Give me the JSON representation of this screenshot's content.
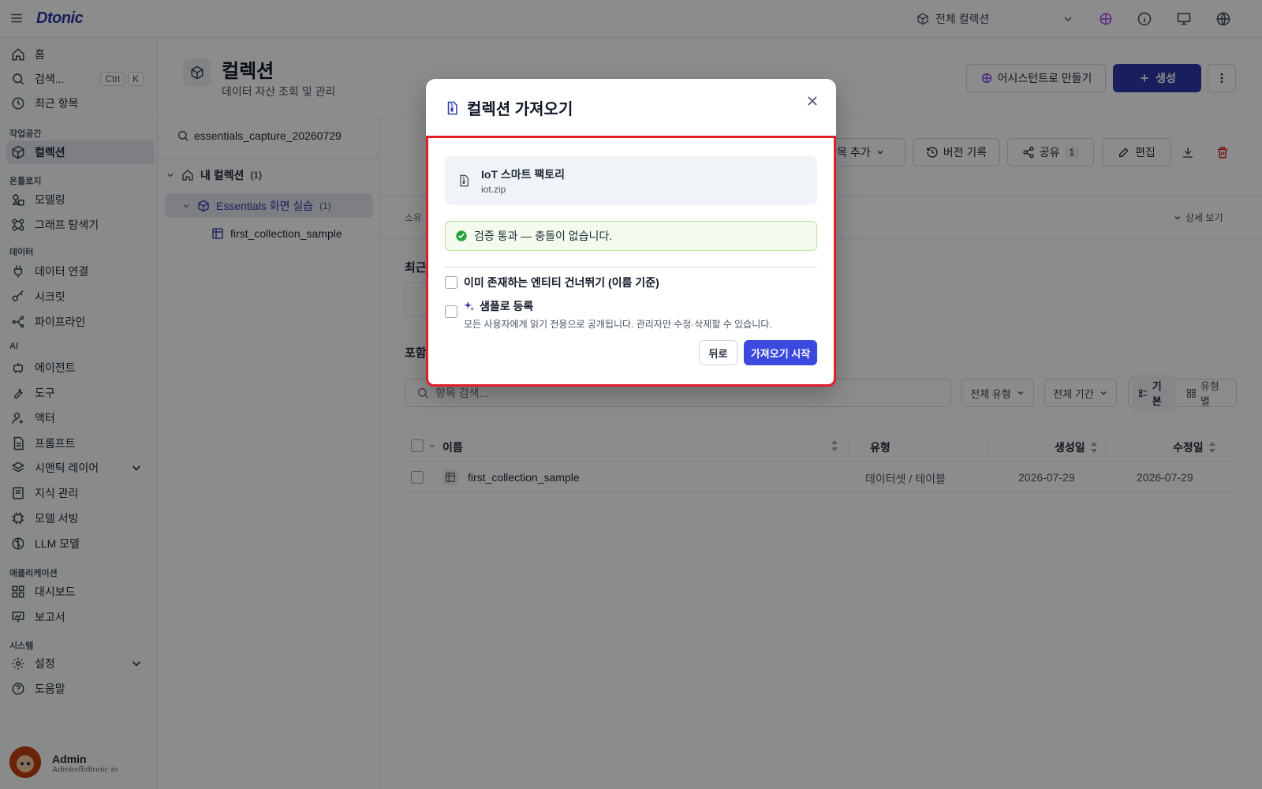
{
  "app": {
    "logo": "Dtonic"
  },
  "topbar": {
    "collection_select": "전체 컬렉션"
  },
  "sidebar": {
    "home": "홈",
    "search": "검색...",
    "search_kbd": [
      "Ctrl",
      "K"
    ],
    "recent": "최근 항목",
    "sections": {
      "workspace": "작업공간",
      "ontology": "온톨로지",
      "data": "데이터",
      "ai": "AI",
      "applications": "애플리케이션",
      "system": "시스템"
    },
    "items": {
      "collections": "컬렉션",
      "modeling": "모델링",
      "graph_explorer": "그래프 탐색기",
      "data_connect": "데이터 연결",
      "secrets": "시크릿",
      "pipelines": "파이프라인",
      "agents": "에이전트",
      "tools": "도구",
      "actors": "액터",
      "prompts": "프롬프트",
      "semantic_layer": "시맨틱 레이어",
      "knowledge": "지식 관리",
      "model_serving": "모델 서빙",
      "llm_models": "LLM 모델",
      "dashboards": "대시보드",
      "reports": "보고서",
      "settings": "설정",
      "help": "도움말"
    },
    "user": {
      "name": "Admin",
      "email": "Admin@dtonic.io"
    }
  },
  "page": {
    "title": "컬렉션",
    "subtitle": "데이터 자산 조회 및 관리",
    "assistant_button": "어시스턴트로 만들기",
    "create_button": "생성"
  },
  "tree": {
    "search_value": "essentials_capture_20260729",
    "root_label": "내 컬렉션",
    "root_count": "(1)",
    "child_label": "Essentials 화면 실습",
    "child_count": "(1)",
    "leaf_label": "first_collection_sample"
  },
  "main": {
    "toolbar": {
      "add_item": "항목 추가",
      "version_history": "버전 기록",
      "share": "공유",
      "share_count": "1",
      "edit": "편집"
    },
    "owner_fragment": "소유",
    "detail_view": "상세 보기",
    "recent_fragment": "최근",
    "included_fragment": "포함",
    "search_placeholder": "항목 검색...",
    "filters": {
      "type": "전체 유형",
      "period": "전체 기간",
      "view_basic": "기본",
      "view_by_type": "유형별"
    },
    "table": {
      "headers": {
        "name": "이름",
        "type": "유형",
        "created": "생성일",
        "modified": "수정일"
      },
      "rows": [
        {
          "name": "first_collection_sample",
          "type": "데이터셋 / 테이블",
          "created": "2026-07-29",
          "modified": "2026-07-29"
        }
      ]
    }
  },
  "modal": {
    "title": "컬렉션 가져오기",
    "file_title": "IoT 스마트 팩토리",
    "file_name": "iot.zip",
    "validation_message": "검증 통과 — 충돌이 없습니다.",
    "option_skip": "이미 존재하는 엔티티 건너뛰기 (이름 기준)",
    "option_sample": "샘플로 등록",
    "option_sample_desc": "모든 사용자에게 읽기 전용으로 공개됩니다. 관리자만 수정·삭제할 수 있습니다.",
    "back_button": "뒤로",
    "start_button": "가져오기 시작"
  },
  "colors": {
    "accent": "#2f3aa8",
    "highlight_border": "#e11d2a",
    "success": "#22a33a"
  }
}
